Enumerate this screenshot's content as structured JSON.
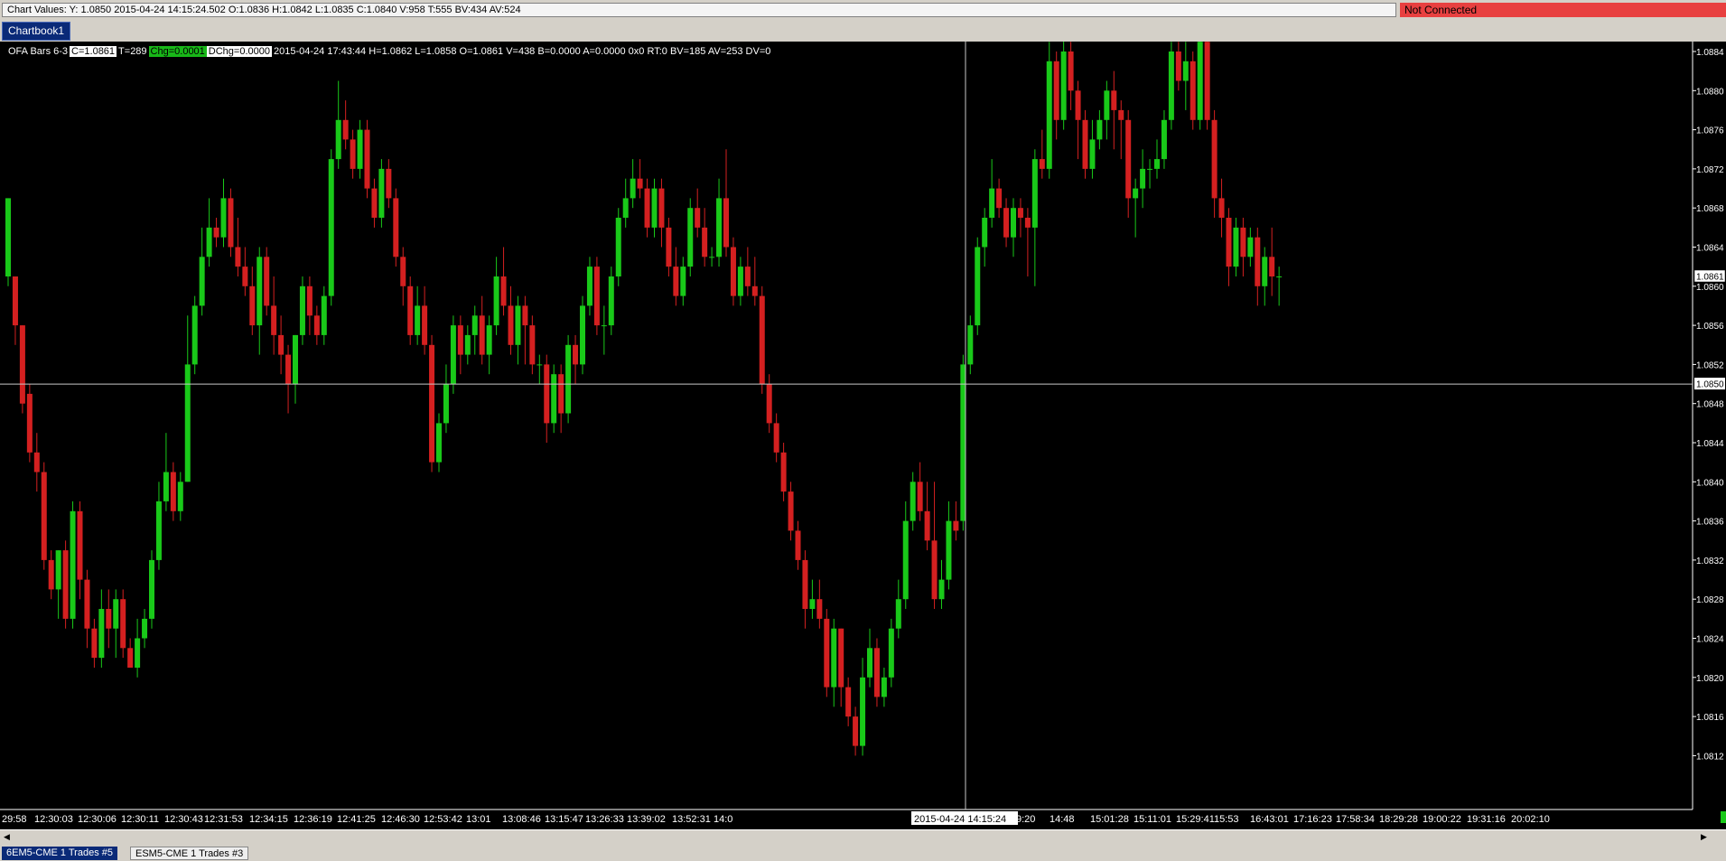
{
  "chart_values_text": "Chart Values: Y: 1.0850  2015-04-24  14:15:24.502  O:1.0836  H:1.0842  L:1.0835  C:1.0840  V:958  T:555  BV:434  AV:524",
  "connection_status": "Not Connected",
  "chartbook_tab": "Chartbook1",
  "info_bar": {
    "name": "OFA Bars 6-3",
    "close": "C=1.0861",
    "trades": "T=289",
    "chg": "Chg=0.0001",
    "dchg": "DChg=0.0000",
    "rest": "2015-04-24 17:43:44 H=1.0862 L=1.0858 O=1.0861 V=438 B=0.0000 A=0.0000 0x0 RT:0 BV=185 AV=253 DV=0"
  },
  "bottom_tabs": [
    "6EM5-CME  1 Trades  #5",
    "ESM5-CME  1 Trades  #3"
  ],
  "colors": {
    "up": "#19c919",
    "down": "#d42020",
    "crosshair": "#c8c8c8",
    "text": "#ffffff"
  },
  "chart_data": {
    "type": "candlestick",
    "y_ticks": [
      "1.0884",
      "1.0880",
      "1.0876",
      "1.0872",
      "1.0868",
      "1.0864",
      "1.0860",
      "1.0856",
      "1.0852",
      "1.0848",
      "1.0844",
      "1.0840",
      "1.0836",
      "1.0832",
      "1.0828",
      "1.0824",
      "1.0820",
      "1.0816",
      "1.0812"
    ],
    "y_range": [
      1.0811,
      1.0887
    ],
    "x_ticks": [
      "29:58",
      "12:30:03",
      "12:30:06",
      "12:30:11",
      "12:30:43",
      "12:31:53",
      "12:34:15",
      "12:36:19",
      "12:41:25",
      "12:46:30",
      "12:53:42",
      "13:01",
      "13:08:46",
      "13:15:47",
      "13:26:33",
      "13:39:02",
      "13:52:31",
      "14:0",
      "9:20",
      "14:48",
      "15:01:28",
      "15:11:01",
      "15:29:41",
      "15:53",
      "16:43:01",
      "17:16:23",
      "17:58:34",
      "18:29:28",
      "19:00:22",
      "19:31:16",
      "20:02:10"
    ],
    "crosshair_price": "1.0850",
    "crosshair_time": "2015-04-24  14:15:24",
    "last_price": "1.0861",
    "bars": [
      [
        1.0861,
        1.0869,
        1.0869,
        1.086
      ],
      [
        1.0861,
        1.0856,
        1.0861,
        1.0854
      ],
      [
        1.0856,
        1.0848,
        1.0856,
        1.0847
      ],
      [
        1.0849,
        1.0843,
        1.085,
        1.0842
      ],
      [
        1.0843,
        1.0841,
        1.0845,
        1.0839
      ],
      [
        1.0841,
        1.0832,
        1.0842,
        1.0831
      ],
      [
        1.0832,
        1.0829,
        1.0833,
        1.0828
      ],
      [
        1.0829,
        1.0833,
        1.0833,
        1.0826
      ],
      [
        1.0833,
        1.0826,
        1.0834,
        1.0825
      ],
      [
        1.0826,
        1.0837,
        1.0838,
        1.0825
      ],
      [
        1.0837,
        1.083,
        1.0838,
        1.0828
      ],
      [
        1.083,
        1.0825,
        1.0831,
        1.0823
      ],
      [
        1.0825,
        1.0822,
        1.0826,
        1.0821
      ],
      [
        1.0822,
        1.0827,
        1.0829,
        1.0821
      ],
      [
        1.0827,
        1.0825,
        1.0829,
        1.0823
      ],
      [
        1.0825,
        1.0828,
        1.0829,
        1.0822
      ],
      [
        1.0828,
        1.0823,
        1.0829,
        1.0822
      ],
      [
        1.0823,
        1.0821,
        1.0824,
        1.0821
      ],
      [
        1.0821,
        1.0824,
        1.0826,
        1.082
      ],
      [
        1.0824,
        1.0826,
        1.0827,
        1.0823
      ],
      [
        1.0826,
        1.0832,
        1.0833,
        1.0825
      ],
      [
        1.0832,
        1.0838,
        1.084,
        1.0831
      ],
      [
        1.0838,
        1.0841,
        1.0845,
        1.0837
      ],
      [
        1.0841,
        1.0837,
        1.0842,
        1.0836
      ],
      [
        1.0837,
        1.084,
        1.0841,
        1.0836
      ],
      [
        1.084,
        1.0852,
        1.0857,
        1.084
      ],
      [
        1.0852,
        1.0858,
        1.0859,
        1.0851
      ],
      [
        1.0858,
        1.0863,
        1.0866,
        1.0857
      ],
      [
        1.0863,
        1.0866,
        1.0869,
        1.0862
      ],
      [
        1.0866,
        1.0865,
        1.0867,
        1.0864
      ],
      [
        1.0865,
        1.0869,
        1.0871,
        1.0864
      ],
      [
        1.0869,
        1.0864,
        1.087,
        1.0863
      ],
      [
        1.0864,
        1.0862,
        1.0867,
        1.0861
      ],
      [
        1.0862,
        1.086,
        1.0864,
        1.0859
      ],
      [
        1.086,
        1.0856,
        1.0862,
        1.0855
      ],
      [
        1.0856,
        1.0863,
        1.0864,
        1.0853
      ],
      [
        1.0863,
        1.0858,
        1.0864,
        1.0857
      ],
      [
        1.0858,
        1.0855,
        1.0861,
        1.0853
      ],
      [
        1.0855,
        1.0853,
        1.0857,
        1.0851
      ],
      [
        1.0853,
        1.085,
        1.0854,
        1.0847
      ],
      [
        1.085,
        1.0855,
        1.0855,
        1.0848
      ],
      [
        1.0855,
        1.086,
        1.0861,
        1.0854
      ],
      [
        1.086,
        1.0857,
        1.0861,
        1.0855
      ],
      [
        1.0857,
        1.0855,
        1.0858,
        1.0854
      ],
      [
        1.0855,
        1.0859,
        1.086,
        1.0854
      ],
      [
        1.0859,
        1.0873,
        1.0874,
        1.0858
      ],
      [
        1.0873,
        1.0877,
        1.0881,
        1.0872
      ],
      [
        1.0877,
        1.0875,
        1.0879,
        1.0874
      ],
      [
        1.0875,
        1.0872,
        1.0876,
        1.0871
      ],
      [
        1.0872,
        1.0876,
        1.0877,
        1.0871
      ],
      [
        1.0876,
        1.087,
        1.0877,
        1.0869
      ],
      [
        1.087,
        1.0867,
        1.0871,
        1.0866
      ],
      [
        1.0867,
        1.0872,
        1.0873,
        1.0866
      ],
      [
        1.0872,
        1.0869,
        1.0873,
        1.0868
      ],
      [
        1.0869,
        1.0863,
        1.087,
        1.0862
      ],
      [
        1.0863,
        1.086,
        1.0864,
        1.0858
      ],
      [
        1.086,
        1.0855,
        1.0861,
        1.0854
      ],
      [
        1.0855,
        1.0858,
        1.086,
        1.0854
      ],
      [
        1.0858,
        1.0854,
        1.086,
        1.0853
      ],
      [
        1.0854,
        1.0842,
        1.0855,
        1.0841
      ],
      [
        1.0842,
        1.0846,
        1.0847,
        1.0841
      ],
      [
        1.0846,
        1.085,
        1.0852,
        1.0845
      ],
      [
        1.085,
        1.0856,
        1.0857,
        1.0849
      ],
      [
        1.0856,
        1.0853,
        1.0857,
        1.0851
      ],
      [
        1.0853,
        1.0855,
        1.0856,
        1.0852
      ],
      [
        1.0855,
        1.0857,
        1.0858,
        1.0853
      ],
      [
        1.0857,
        1.0853,
        1.0859,
        1.0852
      ],
      [
        1.0853,
        1.0856,
        1.0857,
        1.0851
      ],
      [
        1.0856,
        1.0861,
        1.0863,
        1.0855
      ],
      [
        1.0861,
        1.0858,
        1.0864,
        1.0857
      ],
      [
        1.0858,
        1.0854,
        1.086,
        1.0853
      ],
      [
        1.0854,
        1.0858,
        1.0859,
        1.0852
      ],
      [
        1.0858,
        1.0856,
        1.0859,
        1.0852
      ],
      [
        1.0856,
        1.0852,
        1.0857,
        1.0851
      ],
      [
        1.0852,
        1.0852,
        1.0853,
        1.085
      ],
      [
        1.0852,
        1.0846,
        1.0853,
        1.0844
      ],
      [
        1.0846,
        1.0851,
        1.0852,
        1.0845
      ],
      [
        1.0851,
        1.0847,
        1.0852,
        1.0845
      ],
      [
        1.0847,
        1.0854,
        1.0855,
        1.0846
      ],
      [
        1.0854,
        1.0852,
        1.0855,
        1.085
      ],
      [
        1.0852,
        1.0858,
        1.0859,
        1.0851
      ],
      [
        1.0858,
        1.0862,
        1.0863,
        1.0857
      ],
      [
        1.0862,
        1.0856,
        1.0863,
        1.0855
      ],
      [
        1.0856,
        1.0856,
        1.0858,
        1.0853
      ],
      [
        1.0856,
        1.0861,
        1.0862,
        1.0855
      ],
      [
        1.0861,
        1.0867,
        1.0868,
        1.086
      ],
      [
        1.0867,
        1.0869,
        1.0871,
        1.0866
      ],
      [
        1.0869,
        1.0871,
        1.0873,
        1.0868
      ],
      [
        1.0871,
        1.087,
        1.0873,
        1.0869
      ],
      [
        1.087,
        1.0866,
        1.0871,
        1.0865
      ],
      [
        1.0866,
        1.087,
        1.0871,
        1.0865
      ],
      [
        1.087,
        1.0866,
        1.0871,
        1.0864
      ],
      [
        1.0866,
        1.0862,
        1.0867,
        1.0861
      ],
      [
        1.0862,
        1.0859,
        1.0864,
        1.0858
      ],
      [
        1.0859,
        1.0862,
        1.0863,
        1.0858
      ],
      [
        1.0862,
        1.0868,
        1.0869,
        1.0861
      ],
      [
        1.0868,
        1.0866,
        1.087,
        1.0865
      ],
      [
        1.0866,
        1.0863,
        1.0868,
        1.0862
      ],
      [
        1.0863,
        1.0863,
        1.0864,
        1.0862
      ],
      [
        1.0863,
        1.0869,
        1.0871,
        1.0862
      ],
      [
        1.0869,
        1.0864,
        1.0874,
        1.0863
      ],
      [
        1.0864,
        1.0859,
        1.0865,
        1.0858
      ],
      [
        1.0859,
        1.0862,
        1.0863,
        1.0858
      ],
      [
        1.0862,
        1.086,
        1.0864,
        1.0859
      ],
      [
        1.086,
        1.0859,
        1.0863,
        1.0858
      ],
      [
        1.0859,
        1.085,
        1.086,
        1.0849
      ],
      [
        1.085,
        1.0846,
        1.0851,
        1.0845
      ],
      [
        1.0846,
        1.0843,
        1.0847,
        1.0842
      ],
      [
        1.0843,
        1.0839,
        1.0844,
        1.0838
      ],
      [
        1.0839,
        1.0835,
        1.084,
        1.0834
      ],
      [
        1.0835,
        1.0832,
        1.0836,
        1.0831
      ],
      [
        1.0832,
        1.0827,
        1.0833,
        1.0825
      ],
      [
        1.0827,
        1.0828,
        1.083,
        1.0826
      ],
      [
        1.0828,
        1.0826,
        1.083,
        1.0825
      ],
      [
        1.0826,
        1.0819,
        1.0827,
        1.0818
      ],
      [
        1.0819,
        1.0825,
        1.0826,
        1.0817
      ],
      [
        1.0825,
        1.0819,
        1.0825,
        1.0817
      ],
      [
        1.0819,
        1.0816,
        1.082,
        1.0815
      ],
      [
        1.0816,
        1.0813,
        1.0817,
        1.0812
      ],
      [
        1.0813,
        1.082,
        1.0822,
        1.0812
      ],
      [
        1.082,
        1.0823,
        1.0825,
        1.0819
      ],
      [
        1.0823,
        1.0818,
        1.0824,
        1.0817
      ],
      [
        1.0818,
        1.082,
        1.0821,
        1.0817
      ],
      [
        1.082,
        1.0825,
        1.0826,
        1.0819
      ],
      [
        1.0825,
        1.0828,
        1.083,
        1.0824
      ],
      [
        1.0828,
        1.0836,
        1.0838,
        1.0827
      ],
      [
        1.0836,
        1.084,
        1.0841,
        1.0835
      ],
      [
        1.084,
        1.0837,
        1.0842,
        1.0836
      ],
      [
        1.0837,
        1.0834,
        1.084,
        1.0833
      ],
      [
        1.0834,
        1.0828,
        1.084,
        1.0827
      ],
      [
        1.0828,
        1.083,
        1.0832,
        1.0827
      ],
      [
        1.083,
        1.0836,
        1.0838,
        1.0829
      ],
      [
        1.0836,
        1.0835,
        1.0838,
        1.0834
      ],
      [
        1.0836,
        1.0852,
        1.0853,
        1.0835
      ],
      [
        1.0852,
        1.0856,
        1.0857,
        1.0851
      ],
      [
        1.0856,
        1.0864,
        1.0865,
        1.0855
      ],
      [
        1.0864,
        1.0867,
        1.0868,
        1.0862
      ],
      [
        1.0867,
        1.087,
        1.0873,
        1.0866
      ],
      [
        1.087,
        1.0868,
        1.0871,
        1.0867
      ],
      [
        1.0868,
        1.0865,
        1.0869,
        1.0864
      ],
      [
        1.0865,
        1.0868,
        1.0869,
        1.0863
      ],
      [
        1.0868,
        1.0867,
        1.0869,
        1.0865
      ],
      [
        1.0867,
        1.0866,
        1.0868,
        1.0861
      ],
      [
        1.0866,
        1.0873,
        1.0874,
        1.086
      ],
      [
        1.0873,
        1.0872,
        1.0876,
        1.0871
      ],
      [
        1.0872,
        1.0883,
        1.0885,
        1.0871
      ],
      [
        1.0883,
        1.0877,
        1.0884,
        1.0875
      ],
      [
        1.0877,
        1.0884,
        1.0886,
        1.0876
      ],
      [
        1.0884,
        1.088,
        1.0885,
        1.0878
      ],
      [
        1.088,
        1.0877,
        1.0881,
        1.0873
      ],
      [
        1.0877,
        1.0872,
        1.0878,
        1.0871
      ],
      [
        1.0872,
        1.0875,
        1.0877,
        1.0871
      ],
      [
        1.0875,
        1.0877,
        1.0878,
        1.0874
      ],
      [
        1.0877,
        1.088,
        1.0881,
        1.0875
      ],
      [
        1.088,
        1.0878,
        1.0882,
        1.0874
      ],
      [
        1.0878,
        1.0877,
        1.0879,
        1.0873
      ],
      [
        1.0877,
        1.0869,
        1.0878,
        1.0867
      ],
      [
        1.0869,
        1.087,
        1.0871,
        1.0865
      ],
      [
        1.087,
        1.0872,
        1.0874,
        1.0868
      ],
      [
        1.0872,
        1.0872,
        1.0873,
        1.087
      ],
      [
        1.0872,
        1.0873,
        1.0875,
        1.0871
      ],
      [
        1.0873,
        1.0877,
        1.0878,
        1.0872
      ],
      [
        1.0877,
        1.0884,
        1.0885,
        1.0876
      ],
      [
        1.0884,
        1.0881,
        1.0885,
        1.088
      ],
      [
        1.0881,
        1.0883,
        1.0885,
        1.0878
      ],
      [
        1.0883,
        1.0877,
        1.0884,
        1.0876
      ],
      [
        1.0877,
        1.0885,
        1.0886,
        1.0876
      ],
      [
        1.0885,
        1.0877,
        1.0885,
        1.0876
      ],
      [
        1.0877,
        1.0869,
        1.0878,
        1.0867
      ],
      [
        1.0869,
        1.0867,
        1.0871,
        1.0865
      ],
      [
        1.0867,
        1.0862,
        1.0868,
        1.086
      ],
      [
        1.0862,
        1.0866,
        1.0867,
        1.0861
      ],
      [
        1.0866,
        1.0863,
        1.0867,
        1.0861
      ],
      [
        1.0863,
        1.0865,
        1.0866,
        1.0862
      ],
      [
        1.0865,
        1.086,
        1.0866,
        1.0858
      ],
      [
        1.086,
        1.0863,
        1.0864,
        1.0858
      ],
      [
        1.0863,
        1.0861,
        1.0866,
        1.0859
      ],
      [
        1.0861,
        1.0861,
        1.0862,
        1.0858
      ]
    ]
  }
}
